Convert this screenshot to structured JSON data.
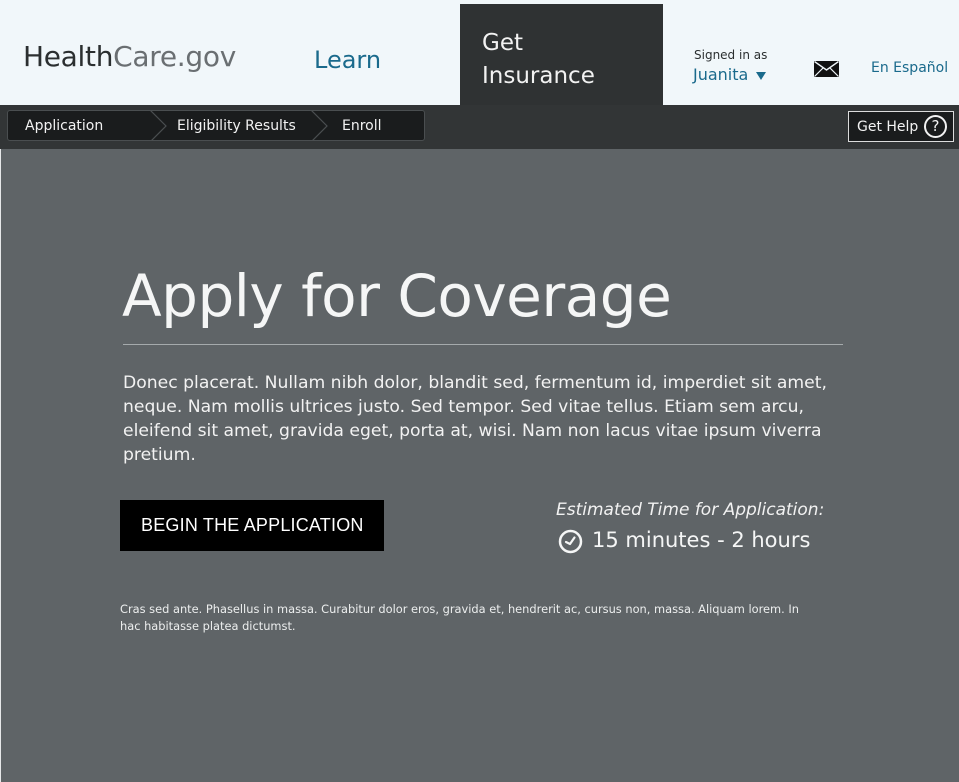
{
  "header": {
    "logo": {
      "part1": "Health",
      "part2": "Care",
      "part3": ".gov"
    },
    "nav_learn": "Learn",
    "nav_get_line1": "Get",
    "nav_get_line2": "Insurance",
    "signed_in_label": "Signed in as",
    "user_name": "Juanita",
    "language_link": "En Español",
    "icons": {
      "messages": "mail-icon",
      "user_menu": "caret-down-icon"
    }
  },
  "navbar": {
    "steps": [
      "Application",
      "Eligibility Results",
      "Enroll"
    ],
    "help_label": "Get Help",
    "help_icon_glyph": "?"
  },
  "main": {
    "title": "Apply for Coverage",
    "intro": "Donec placerat. Nullam nibh dolor, blandit sed, fermentum id, imperdiet sit amet, neque. Nam mollis ultrices justo. Sed tempor. Sed vitae tellus. Etiam sem arcu, eleifend sit amet, gravida eget, porta at, wisi. Nam non lacus vitae ipsum viverra pretium.",
    "begin_button": "BEGIN THE APPLICATION",
    "estimate_label": "Estimated Time for Application:",
    "estimate_value": "15 minutes - 2 hours",
    "footnote": "Cras sed ante. Phasellus in massa. Curabitur dolor eros, gravida et, hendrerit ac, cursus non, massa. Aliquam lorem. In hac habitasse platea dictumst."
  },
  "colors": {
    "header_bg": "#f1f7fa",
    "link_blue": "#1a6a8c",
    "active_tab_bg": "#2f3233",
    "navbar_bg": "#323536",
    "page_bg": "#5f6467",
    "button_bg": "#000000"
  }
}
